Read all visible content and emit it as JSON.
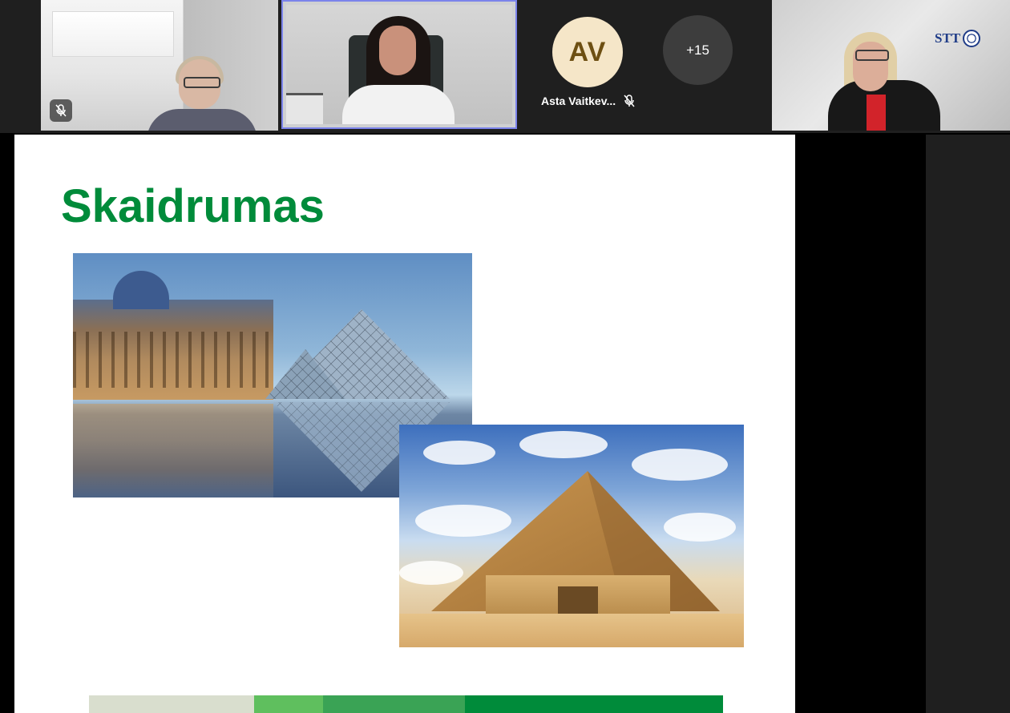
{
  "participants": {
    "tile_a": {
      "muted": true
    },
    "active_speaker": {},
    "avatar": {
      "initials": "AV",
      "name": "Asta Vaitkev...",
      "muted": true
    },
    "overflow": {
      "label": "+15"
    },
    "tile_c": {
      "logo_text": "STT"
    }
  },
  "slide": {
    "title": "Skaidrumas",
    "title_color": "#008b3a",
    "images": [
      "louvre-pyramid-photo",
      "giza-pyramid-photo"
    ],
    "color_bar": [
      "#d9dece",
      "#5fbf5e",
      "#3aa355",
      "#008b3a"
    ]
  },
  "colors": {
    "strip_bg": "#1f1f1f",
    "active_border": "#7b83eb",
    "avatar_bg": "#f5e6c8",
    "avatar_text": "#6d4f12"
  }
}
